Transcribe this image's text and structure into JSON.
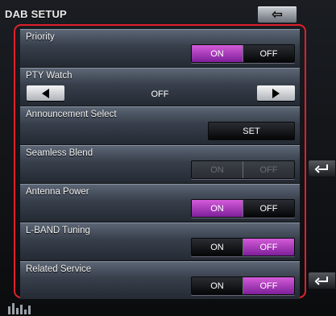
{
  "header": {
    "title": "DAB SETUP",
    "back_icon": "back-arrow-icon"
  },
  "rows": {
    "priority": {
      "label": "Priority",
      "on": "ON",
      "off": "OFF",
      "selected": "ON"
    },
    "pty_watch": {
      "label": "PTY Watch",
      "value": "OFF"
    },
    "announcement": {
      "label": "Announcement Select",
      "button": "SET"
    },
    "seamless_blend": {
      "label": "Seamless Blend",
      "on": "ON",
      "off": "OFF",
      "enabled": false
    },
    "antenna_power": {
      "label": "Antenna Power",
      "on": "ON",
      "off": "OFF",
      "selected": "ON"
    },
    "lband_tuning": {
      "label": "L-BAND Tuning",
      "on": "ON",
      "off": "OFF",
      "selected": "OFF"
    },
    "related_service": {
      "label": "Related Service",
      "on": "ON",
      "off": "OFF",
      "selected": "OFF"
    }
  },
  "colors": {
    "highlight_border": "#e0202b",
    "selected": "#a93ac0"
  }
}
